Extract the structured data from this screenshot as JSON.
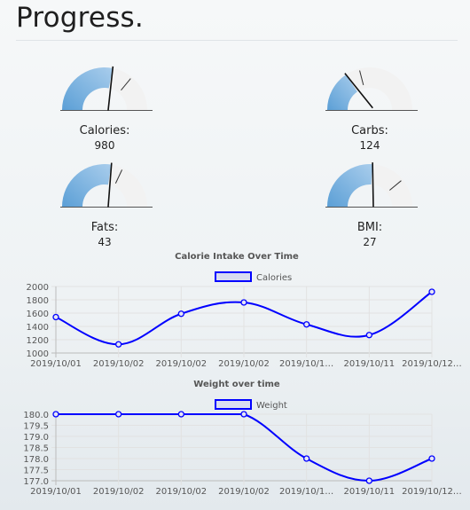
{
  "page": {
    "title": "Progress."
  },
  "gauges": [
    {
      "label": "Calories:",
      "value": "980",
      "fraction": 0.56,
      "target": 0.72
    },
    {
      "label": "Carbs:",
      "value": "124",
      "fraction": 0.31,
      "target": 0.42
    },
    {
      "label": "Fats:",
      "value": "43",
      "fraction": 0.55,
      "target": 0.64
    },
    {
      "label": "BMI:",
      "value": "27",
      "fraction": 0.52,
      "target": 0.78
    }
  ],
  "chart_data": [
    {
      "type": "line",
      "title": "Calorie Intake Over Time",
      "legend": "top",
      "series": [
        {
          "name": "Calories",
          "values": [
            1540,
            1130,
            1590,
            1760,
            1430,
            1270,
            1920
          ]
        }
      ],
      "categories": [
        "2019/10/01",
        "2019/10/02",
        "2019/10/02",
        "2019/10/02",
        "2019/10/10",
        "2019/10/11",
        "2019/10/12"
      ],
      "tick_labels": [
        "2019/10/01",
        "2019/10/02",
        "2019/10/02",
        "2019/10/02",
        "2019/10/1…",
        "2019/10/11",
        "2019/10/12…"
      ],
      "y_ticks": [
        "2000",
        "1800",
        "1600",
        "1400",
        "1200",
        "1000"
      ],
      "ylim": [
        1000,
        2000
      ],
      "grid": true,
      "color": "#0000ff"
    },
    {
      "type": "line",
      "title": "Weight over time",
      "legend": "top",
      "series": [
        {
          "name": "Weight",
          "values": [
            180.0,
            180.0,
            180.0,
            180.0,
            178.0,
            177.0,
            178.0
          ]
        }
      ],
      "categories": [
        "2019/10/01",
        "2019/10/02",
        "2019/10/02",
        "2019/10/02",
        "2019/10/10",
        "2019/10/11",
        "2019/10/12"
      ],
      "tick_labels": [
        "2019/10/01",
        "2019/10/02",
        "2019/10/02",
        "2019/10/02",
        "2019/10/1…",
        "2019/10/11",
        "2019/10/12…"
      ],
      "y_ticks": [
        "180.0",
        "179.5",
        "179.0",
        "178.5",
        "178.0",
        "177.5",
        "177.0"
      ],
      "ylim": [
        177,
        180
      ],
      "grid": true,
      "color": "#0000ff"
    }
  ]
}
